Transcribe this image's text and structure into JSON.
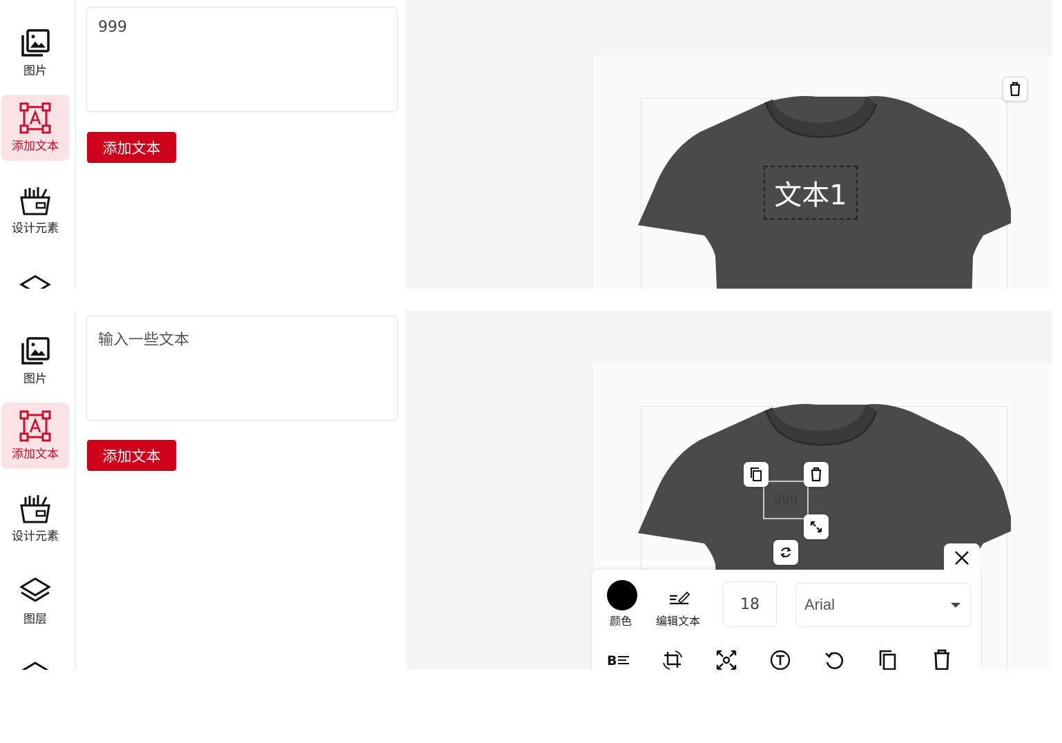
{
  "sidebar": {
    "items": [
      {
        "label": "图片",
        "icon": "image-gallery-icon"
      },
      {
        "label": "添加文本",
        "icon": "add-text-icon",
        "active": true
      },
      {
        "label": "设计元素",
        "icon": "design-elements-icon"
      },
      {
        "label": "图层",
        "icon": "layers-icon"
      }
    ]
  },
  "top": {
    "textarea_value": "999",
    "add_button": "添加文本",
    "canvas_text": "文本1"
  },
  "bottom": {
    "textarea_placeholder": "输入一些文本",
    "add_button": "添加文本",
    "selected_text": "999",
    "toolbar": {
      "color_label": "颜色",
      "color_value": "#000000",
      "edit_text_label": "编辑文本",
      "font_size": "18",
      "font_family": "Arial"
    }
  },
  "colors": {
    "accent": "#d0021b",
    "active_bg": "#fbe3e5",
    "shirt": "#4a4a4a"
  }
}
